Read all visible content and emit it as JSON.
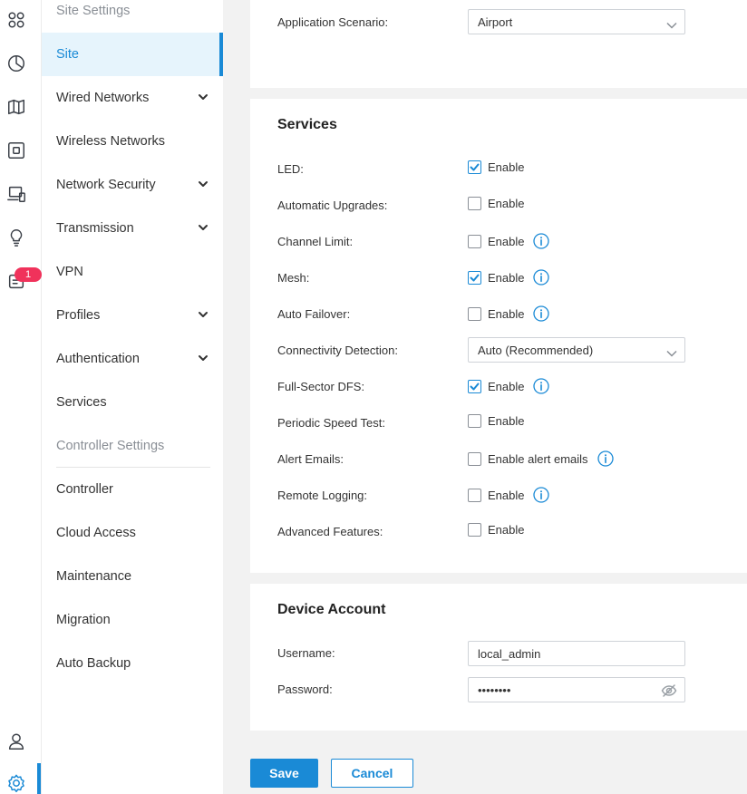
{
  "rail": {
    "icons": [
      "apps-icon",
      "chart-pie-icon",
      "map-icon",
      "device-icon",
      "devices-icon",
      "lightbulb-icon",
      "alerts-icon",
      "user-icon",
      "gear-icon"
    ],
    "alert_badge": "1"
  },
  "nav": {
    "site_settings_heading": "Site Settings",
    "items": [
      {
        "label": "Site",
        "active": true
      },
      {
        "label": "Wired Networks",
        "expandable": true
      },
      {
        "label": "Wireless Networks"
      },
      {
        "label": "Network Security",
        "expandable": true
      },
      {
        "label": "Transmission",
        "expandable": true
      },
      {
        "label": "VPN"
      },
      {
        "label": "Profiles",
        "expandable": true
      },
      {
        "label": "Authentication",
        "expandable": true
      },
      {
        "label": "Services"
      }
    ],
    "controller_settings_heading": "Controller Settings",
    "controller_items": [
      {
        "label": "Controller"
      },
      {
        "label": "Cloud Access"
      },
      {
        "label": "Maintenance"
      },
      {
        "label": "Migration"
      },
      {
        "label": "Auto Backup"
      }
    ]
  },
  "scenario": {
    "label": "Application Scenario:",
    "value": "Airport"
  },
  "services": {
    "title": "Services",
    "rows": [
      {
        "label": "LED:",
        "type": "checkbox",
        "checked": true,
        "text": "Enable",
        "info": false
      },
      {
        "label": "Automatic Upgrades:",
        "type": "checkbox",
        "checked": false,
        "text": "Enable",
        "info": false
      },
      {
        "label": "Channel Limit:",
        "type": "checkbox",
        "checked": false,
        "text": "Enable",
        "info": true
      },
      {
        "label": "Mesh:",
        "type": "checkbox",
        "checked": true,
        "text": "Enable",
        "info": true
      },
      {
        "label": "Auto Failover:",
        "type": "checkbox",
        "checked": false,
        "text": "Enable",
        "info": true
      },
      {
        "label": "Connectivity Detection:",
        "type": "select",
        "value": "Auto (Recommended)"
      },
      {
        "label": "Full-Sector DFS:",
        "type": "checkbox",
        "checked": true,
        "text": "Enable",
        "info": true
      },
      {
        "label": "Periodic Speed Test:",
        "type": "checkbox",
        "checked": false,
        "text": "Enable",
        "info": false
      },
      {
        "label": "Alert Emails:",
        "type": "checkbox",
        "checked": false,
        "text": "Enable alert emails",
        "info": true
      },
      {
        "label": "Remote Logging:",
        "type": "checkbox",
        "checked": false,
        "text": "Enable",
        "info": true
      },
      {
        "label": "Advanced Features:",
        "type": "checkbox",
        "checked": false,
        "text": "Enable",
        "info": false
      }
    ]
  },
  "device_account": {
    "title": "Device Account",
    "username_label": "Username:",
    "username_value": "local_admin",
    "password_label": "Password:",
    "password_value": "••••••••"
  },
  "actions": {
    "save_label": "Save",
    "cancel_label": "Cancel"
  },
  "colors": {
    "accent": "#1a8ad6",
    "badge": "#f0325b",
    "active_bg": "#e6f4fc"
  }
}
